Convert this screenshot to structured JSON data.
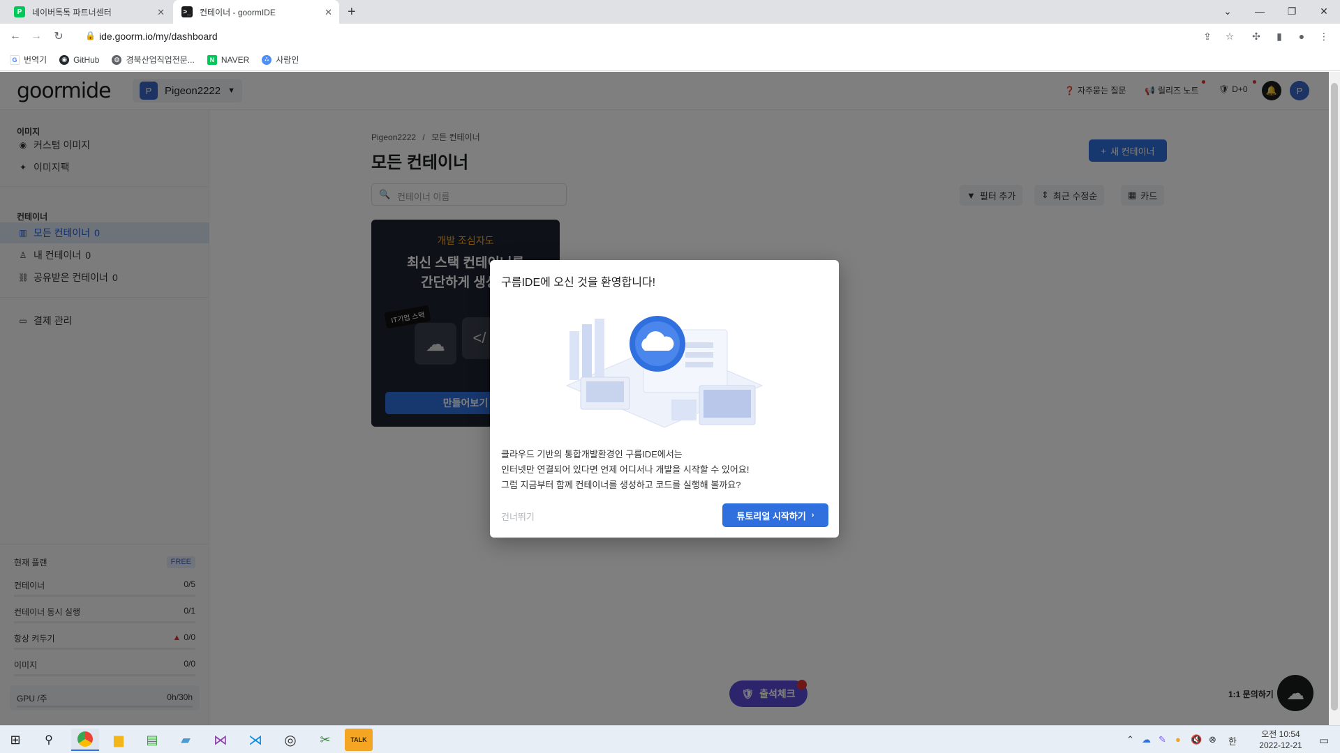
{
  "browser": {
    "tabs": [
      {
        "title": "네이버톡톡 파트너센터",
        "favicon": "naver-talk-icon",
        "active": false
      },
      {
        "title": "컨테이너 - goormIDE",
        "favicon": "goorm-terminal-icon",
        "active": true
      }
    ],
    "new_tab": "+",
    "url": "ide.goorm.io/my/dashboard",
    "bookmarks": [
      {
        "label": "번역기",
        "icon": "google-icon"
      },
      {
        "label": "GitHub",
        "icon": "github-icon"
      },
      {
        "label": "경북산업직업전문...",
        "icon": "globe-icon"
      },
      {
        "label": "NAVER",
        "icon": "naver-icon"
      },
      {
        "label": "사람인",
        "icon": "saramin-icon"
      }
    ]
  },
  "header": {
    "logo": "goormide",
    "workspace": {
      "avatar": "P",
      "name": "Pigeon2222"
    },
    "faq": "자주묻는 질문",
    "release_notes": "릴리즈 노트",
    "dday": "D+0",
    "profile_avatar": "P"
  },
  "sidebar": {
    "image_section": "이미지",
    "custom_image": "커스텀 이미지",
    "image_pack": "이미지팩",
    "container_section": "컨테이너",
    "all_containers": "모든 컨테이너",
    "all_containers_count": "0",
    "my_containers": "내 컨테이너",
    "my_containers_count": "0",
    "shared_containers": "공유받은 컨테이너",
    "shared_containers_count": "0",
    "billing": "결제 관리",
    "plan": {
      "label": "현재 플랜",
      "badge": "FREE",
      "rows": [
        {
          "label": "컨테이너",
          "value": "0/5",
          "usage": 0
        },
        {
          "label": "컨테이너 동시 실행",
          "value": "0/1",
          "usage": 0
        },
        {
          "label": "항상 켜두기",
          "value": "0/0",
          "usage": 0,
          "warning": true
        },
        {
          "label": "이미지",
          "value": "0/0",
          "usage": 0
        }
      ],
      "gpu_label": "GPU /주",
      "gpu_value": "0h/30h",
      "gpu_usage": 0
    }
  },
  "main": {
    "breadcrumb_root": "Pigeon2222",
    "breadcrumb_sep": "/",
    "breadcrumb_current": "모든 컨테이너",
    "title": "모든 컨테이너",
    "new_container": "새 컨테이너",
    "search_placeholder": "컨테이너 이름",
    "filter": "필터 추가",
    "sort": "최근 수정순",
    "view": "카드",
    "promo": {
      "eyebrow": "개발 조심자도",
      "title_line1": "최신 스택 컨테이너를",
      "title_line2": "간단하게 생성해",
      "tag": "IT기업 스택",
      "button": "만들어보기"
    },
    "attendance": "출석체크",
    "inquiry": "1:1 문의하기"
  },
  "modal": {
    "title": "구름IDE에 오신 것을 환영합니다!",
    "body_line1": "클라우드 기반의 통합개발환경인 구름IDE에서는",
    "body_line2": "인터넷만 연결되어 있다면 언제 어디서나 개발을 시작할 수 있어요!",
    "body_line3": "그럼 지금부터 함께 컨테이너를 생성하고 코드를 실행해 볼까요?",
    "skip": "건너뛰기",
    "start": "튜토리얼 시작하기"
  },
  "taskbar": {
    "time": "오전 10:54",
    "date": "2022-12-21",
    "ime": "한"
  },
  "colors": {
    "accent": "#2f6fde",
    "sidebar_active": "#1e5bd8",
    "promo_bg": "#1d2230",
    "promo_eyebrow": "#f5a524",
    "attendance": "#5b4bd6"
  }
}
